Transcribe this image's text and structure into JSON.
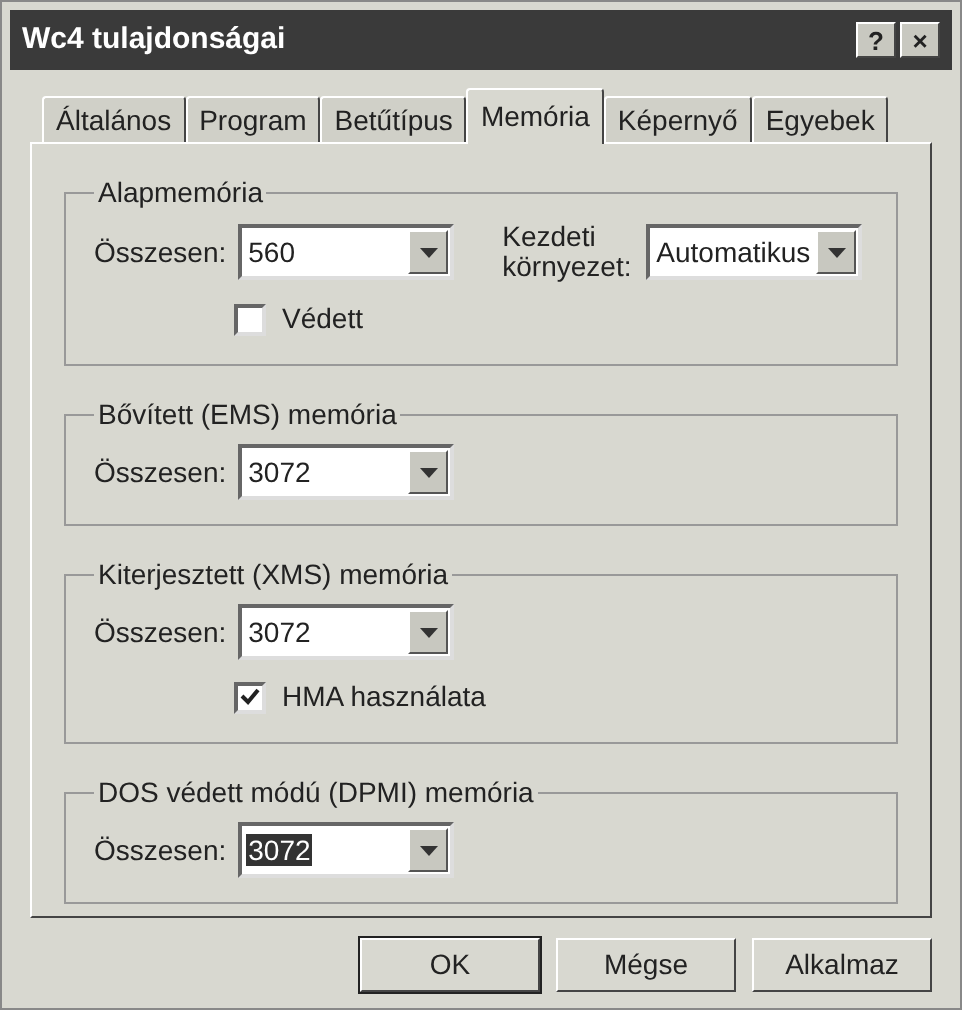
{
  "window": {
    "title": "Wc4 tulajdonságai",
    "title_buttons": [
      "?",
      "×"
    ]
  },
  "tabs": [
    {
      "label": "Általános",
      "selected": false
    },
    {
      "label": "Program",
      "selected": false
    },
    {
      "label": "Betűtípus",
      "selected": false
    },
    {
      "label": "Memória",
      "selected": true
    },
    {
      "label": "Képernyő",
      "selected": false
    },
    {
      "label": "Egyebek",
      "selected": false
    }
  ],
  "groups": [
    {
      "title": "Alapmemória",
      "fields": [
        {
          "label": "Összesen:",
          "value": "560",
          "highlighted": false
        },
        {
          "label": "Kezdeti környezet:",
          "value": "Automatikus",
          "highlighted": false
        }
      ],
      "checkbox": {
        "label": "Védett",
        "checked": false
      }
    },
    {
      "title": "Bővített (EMS) memória",
      "fields": [
        {
          "label": "Összesen:",
          "value": "3072",
          "highlighted": false
        }
      ]
    },
    {
      "title": "Kiterjesztett (XMS) memória",
      "fields": [
        {
          "label": "Összesen:",
          "value": "3072",
          "highlighted": false
        }
      ],
      "checkbox": {
        "label": "HMA használata",
        "checked": true
      }
    },
    {
      "title": "DOS védett módú (DPMI) memória",
      "fields": [
        {
          "label": "Összesen:",
          "value": "3072",
          "highlighted": true
        }
      ]
    }
  ],
  "buttons": [
    {
      "label": "OK",
      "default": true
    },
    {
      "label": "Mégse",
      "default": false
    },
    {
      "label": "Alkalmaz",
      "default": false
    }
  ]
}
